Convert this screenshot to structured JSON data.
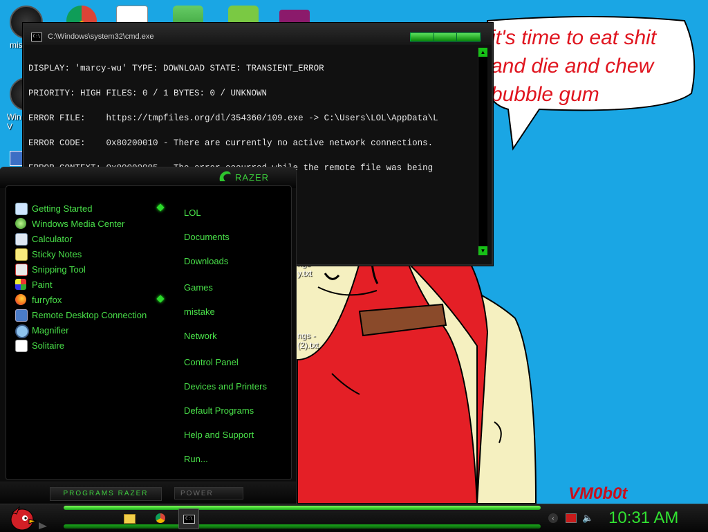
{
  "speech_bubble": {
    "text": "it's time to eat shit\nand die and chew\nbubble gum"
  },
  "signature": "VM0b0t",
  "desktop": {
    "icons": [
      {
        "name": "mi",
        "label": "mis"
      },
      {
        "name": "chrome",
        "label": ""
      },
      {
        "name": "solitaire",
        "label": ""
      },
      {
        "name": "security",
        "label": ""
      },
      {
        "name": "angry-birds",
        "label": ""
      },
      {
        "name": "winrar",
        "label": ""
      },
      {
        "name": "windows",
        "label": "Win\nV"
      }
    ],
    "files": [
      {
        "label": "ngs -\ny.txt"
      },
      {
        "label": "ngs -\n(2).txt"
      }
    ]
  },
  "cmd": {
    "title": "C:\\Windows\\system32\\cmd.exe",
    "lines": [
      "DISPLAY: 'marcy-wu' TYPE: DOWNLOAD STATE: TRANSIENT_ERROR",
      "PRIORITY: HIGH FILES: 0 / 1 BYTES: 0 / UNKNOWN",
      "ERROR FILE:    https://tmpfiles.org/dl/354360/109.exe -> C:\\Users\\LOL\\AppData\\L",
      "ERROR CODE:    0x80200010 - There are currently no active network connections.",
      "ERROR CONTEXT: 0x00000005 - The error occurred while the remote file was being"
    ]
  },
  "start_menu": {
    "brand": "RAZER",
    "programs": [
      {
        "label": "Getting Started",
        "icon": "getting-started-icon",
        "has_submenu": true
      },
      {
        "label": "Windows Media Center",
        "icon": "media-center-icon",
        "has_submenu": false
      },
      {
        "label": "Calculator",
        "icon": "calculator-icon",
        "has_submenu": false
      },
      {
        "label": "Sticky Notes",
        "icon": "sticky-notes-icon",
        "has_submenu": false
      },
      {
        "label": "Snipping Tool",
        "icon": "snipping-tool-icon",
        "has_submenu": false
      },
      {
        "label": "Paint",
        "icon": "paint-icon",
        "has_submenu": false
      },
      {
        "label": "furryfox",
        "icon": "firefox-icon",
        "has_submenu": true
      },
      {
        "label": "Remote Desktop Connection",
        "icon": "remote-desktop-icon",
        "has_submenu": false
      },
      {
        "label": "Magnifier",
        "icon": "magnifier-icon",
        "has_submenu": false
      },
      {
        "label": "Solitaire",
        "icon": "solitaire-icon",
        "has_submenu": false
      }
    ],
    "places": [
      {
        "label": "LOL"
      },
      {
        "label": "Documents"
      },
      {
        "label": "Downloads"
      },
      {
        "label": "Games"
      },
      {
        "label": "mistake"
      },
      {
        "label": "Network"
      },
      {
        "label": "Control Panel"
      },
      {
        "label": "Devices and Printers"
      },
      {
        "label": "Default Programs"
      },
      {
        "label": "Help and Support"
      },
      {
        "label": "Run..."
      }
    ],
    "programs_button": "PROGRAMS  RAZER",
    "power_button": "POWER"
  },
  "taskbar": {
    "clock": "10:31 AM",
    "pinned": [
      "explorer-icon",
      "chrome-icon",
      "cmd-icon"
    ],
    "tray": [
      "back-icon",
      "action-center-icon",
      "volume-icon"
    ]
  },
  "colors": {
    "accent_green": "#49e049",
    "desktop_blue": "#1aa6e4",
    "bubble_text_red": "#e0151f"
  }
}
